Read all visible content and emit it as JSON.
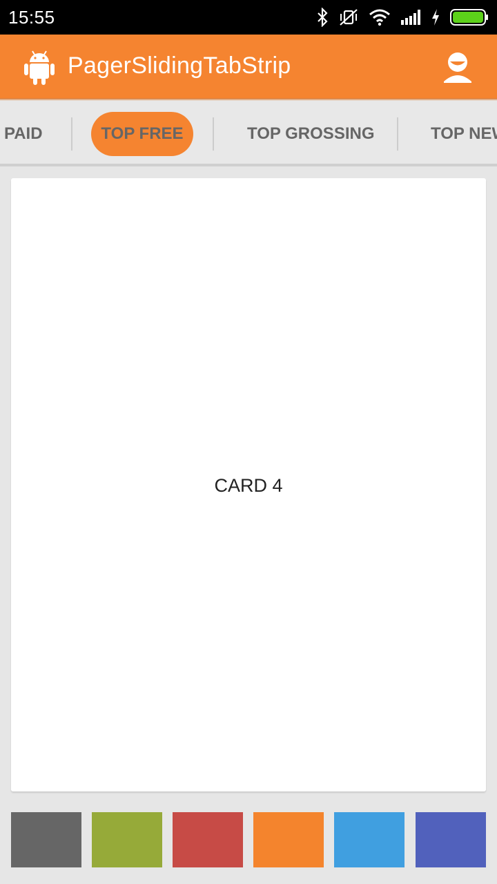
{
  "status_bar": {
    "time": "15:55",
    "icons": [
      "bluetooth-icon",
      "vibrate-off-icon",
      "wifi-icon",
      "signal-icon",
      "charging-icon",
      "battery-icon"
    ]
  },
  "app_bar": {
    "title": "PagerSlidingTabStrip",
    "logo_icon": "android-icon",
    "action_icon": "profile-icon",
    "color": "#f58430"
  },
  "tabs": [
    {
      "label": "PAID",
      "active": false
    },
    {
      "label": "TOP FREE",
      "active": true
    },
    {
      "label": "TOP GROSSING",
      "active": false
    },
    {
      "label": "TOP NEW",
      "active": false
    }
  ],
  "card": {
    "label": "CARD 4"
  },
  "color_swatches": [
    {
      "name": "gray",
      "color": "#666666"
    },
    {
      "name": "olive",
      "color": "#96aa39"
    },
    {
      "name": "red",
      "color": "#c74b46"
    },
    {
      "name": "orange",
      "color": "#f4842d"
    },
    {
      "name": "blue",
      "color": "#409fe0"
    },
    {
      "name": "indigo",
      "color": "#5161bc"
    }
  ]
}
